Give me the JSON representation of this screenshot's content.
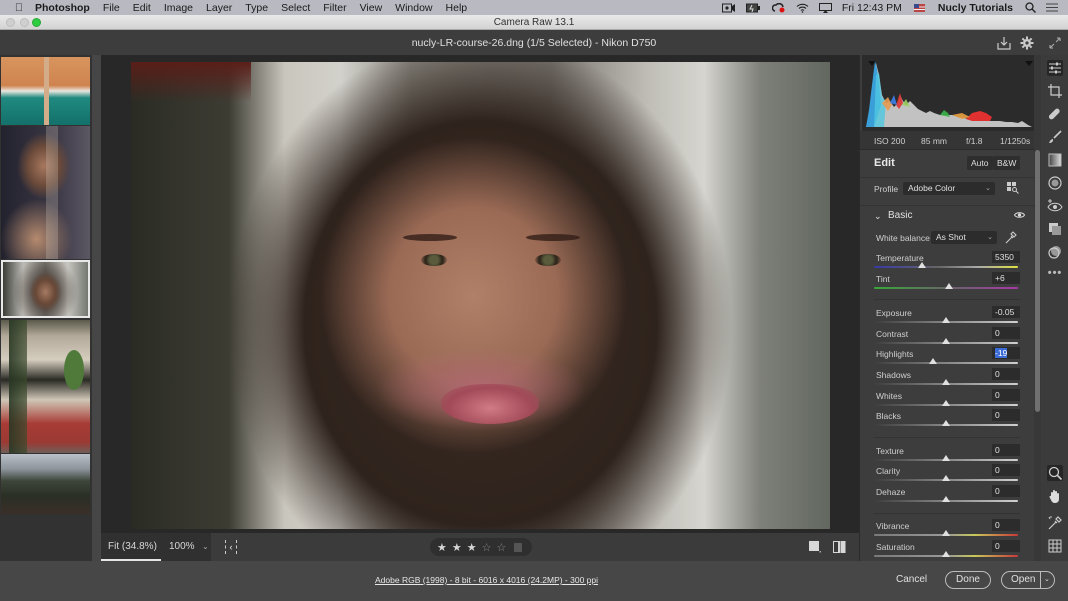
{
  "menubar": {
    "app_name": "Photoshop",
    "items": [
      "File",
      "Edit",
      "Image",
      "Layer",
      "Type",
      "Select",
      "Filter",
      "View",
      "Window",
      "Help"
    ],
    "clock": "Fri 12:43 PM",
    "user": "Nucly Tutorials",
    "status_icons": [
      "screen-record-icon",
      "battery-icon",
      "creative-cloud-icon",
      "wifi-icon",
      "airplay-icon",
      "flag-icon",
      "spotlight-search-icon",
      "notification-center-icon"
    ]
  },
  "window": {
    "title": "Camera Raw 13.1"
  },
  "header": {
    "document_title": "nucly-LR-course-26.dng (1/5 Selected)  -  Nikon D750"
  },
  "filmstrip": {
    "count": 5,
    "selected_index": 2,
    "thumbnails": [
      "beach-aerial",
      "portrait-veil",
      "portrait-curly-hair",
      "building-palms",
      "landscape-hills"
    ]
  },
  "canvas_toolbar": {
    "fit_label": "Fit (34.8%)",
    "zoom_label": "100%",
    "rating": 3,
    "rating_max": 5,
    "stars": [
      "★",
      "★",
      "★",
      "☆",
      "☆"
    ]
  },
  "exif": {
    "iso": "ISO 200",
    "focal_length": "85 mm",
    "aperture": "f/1.8",
    "shutter": "1/1250s"
  },
  "edit_panel": {
    "title": "Edit",
    "auto_label": "Auto",
    "bw_label": "B&W",
    "profile_label": "Profile",
    "profile_value": "Adobe Color",
    "basic_section": "Basic",
    "white_balance_label": "White balance",
    "white_balance_value": "As Shot",
    "sliders": [
      {
        "label": "Temperature",
        "value": "5350",
        "position": 0.33,
        "track": "temp"
      },
      {
        "label": "Tint",
        "value": "+6",
        "position": 0.52,
        "track": "tint"
      },
      {
        "label": "Exposure",
        "value": "-0.05",
        "position": 0.5,
        "track": "gray"
      },
      {
        "label": "Contrast",
        "value": "0",
        "position": 0.5,
        "track": "gray"
      },
      {
        "label": "Highlights",
        "value": "-19",
        "position": 0.41,
        "track": "gray",
        "active": true
      },
      {
        "label": "Shadows",
        "value": "0",
        "position": 0.5,
        "track": "gray"
      },
      {
        "label": "Whites",
        "value": "0",
        "position": 0.5,
        "track": "gray"
      },
      {
        "label": "Blacks",
        "value": "0",
        "position": 0.5,
        "track": "gray"
      },
      {
        "label": "Texture",
        "value": "0",
        "position": 0.5,
        "track": "gray"
      },
      {
        "label": "Clarity",
        "value": "0",
        "position": 0.5,
        "track": "gray"
      },
      {
        "label": "Dehaze",
        "value": "0",
        "position": 0.5,
        "track": "gray"
      },
      {
        "label": "Vibrance",
        "value": "0",
        "position": 0.5,
        "track": "vib"
      },
      {
        "label": "Saturation",
        "value": "0",
        "position": 0.5,
        "track": "vib"
      }
    ]
  },
  "tools": [
    "edit-sliders-icon",
    "crop-icon",
    "healing-icon",
    "brush-icon",
    "gradient-icon",
    "radial-filter-icon",
    "red-eye-icon",
    "snapshots-icon",
    "presets-icon",
    "more-icon",
    "zoom-icon",
    "hand-icon",
    "color-sampler-icon",
    "grid-icon"
  ],
  "footer": {
    "workflow_info": "Adobe RGB (1998) - 8 bit - 6016 x 4016 (24.2MP) - 300 ppi",
    "cancel_label": "Cancel",
    "done_label": "Done",
    "open_label": "Open"
  }
}
